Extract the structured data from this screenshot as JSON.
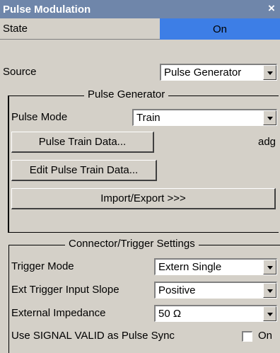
{
  "dialog": {
    "title": "Pulse Modulation",
    "close_glyph": "×"
  },
  "state": {
    "label": "State",
    "value": "On",
    "accent": "#3d7ee6"
  },
  "source": {
    "label": "Source",
    "value": "Pulse Generator"
  },
  "pulse_generator": {
    "title": "Pulse Generator",
    "pulse_mode_label": "Pulse Mode",
    "pulse_mode_value": "Train",
    "train_data_button": "Pulse Train Data...",
    "train_data_file": "adg",
    "edit_button": "Edit Pulse Train Data...",
    "import_export_button": "Import/Export >>>"
  },
  "connector": {
    "title": "Connector/Trigger Settings",
    "trigger_mode_label": "Trigger Mode",
    "trigger_mode_value": "Extern Single",
    "slope_label": "Ext Trigger Input Slope",
    "slope_value": "Positive",
    "impedance_label": "External Impedance",
    "impedance_value": "50 Ω",
    "sync_label": "Use SIGNAL VALID as Pulse Sync",
    "sync_checkbox_label": "On",
    "sync_checked": false
  },
  "icons": {
    "close": "close-icon",
    "dropdown": "chevron-down-icon"
  }
}
